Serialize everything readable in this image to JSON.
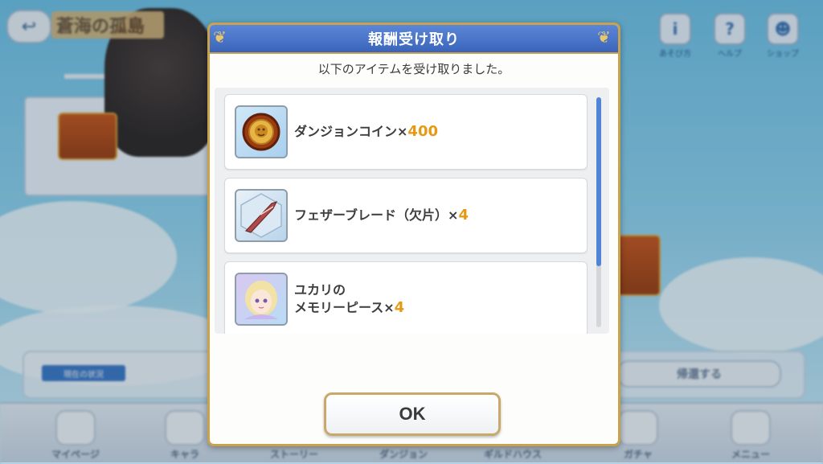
{
  "background": {
    "area_title": "蒼海の孤島",
    "top_icons": [
      {
        "name": "info-icon",
        "glyph": "i",
        "caption": "あそび方"
      },
      {
        "name": "help-icon",
        "glyph": "?",
        "caption": "ヘルプ"
      },
      {
        "name": "shop-icon",
        "glyph": "☻",
        "caption": "ショップ"
      }
    ],
    "bottom_bar": {
      "tag": "現在の状況",
      "button": "帰還する"
    },
    "nav": [
      "マイページ",
      "キャラ",
      "ストーリー",
      "ダンジョン",
      "ギルドハウス",
      "ガチャ",
      "メニュー"
    ]
  },
  "dialog": {
    "title": "報酬受け取り",
    "subtitle": "以下のアイテムを受け取りました。",
    "items": [
      {
        "icon": "lion-coin-icon",
        "name": "ダンジョンコイン×",
        "qty": "400"
      },
      {
        "icon": "feather-blade-icon",
        "name": "フェザーブレード（欠片）×",
        "qty": "4"
      },
      {
        "icon": "yukari-portrait-icon",
        "name_line1": "ユカリの",
        "name_line2": "メモリーピース×",
        "qty": "4"
      }
    ],
    "ok_label": "OK",
    "scroll_position": 0.0
  },
  "colors": {
    "header_blue": "#3a64b9",
    "gold_border": "#c9a24f",
    "qty_orange": "#e69a14",
    "scroll_blue": "#4f84d6"
  }
}
